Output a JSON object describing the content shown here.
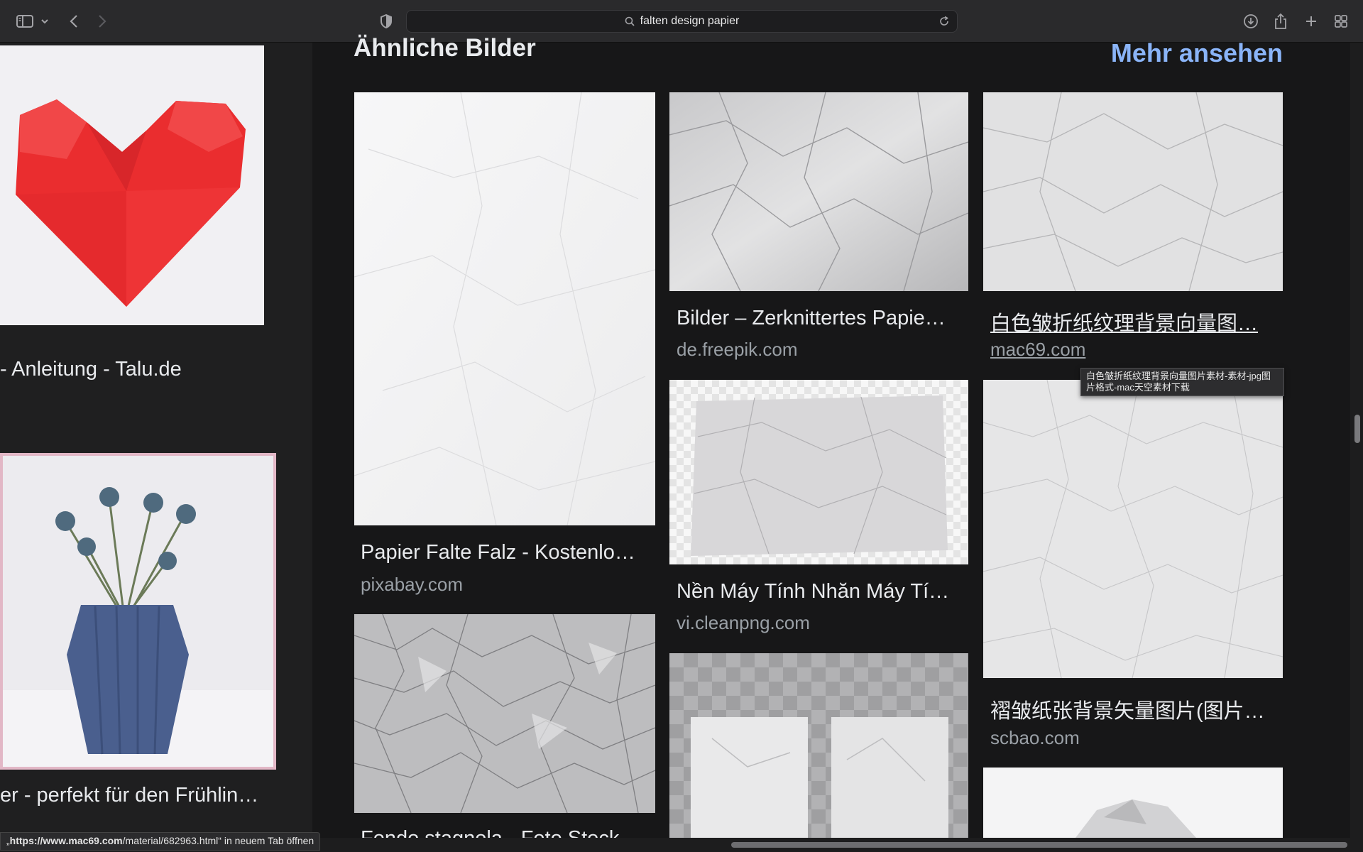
{
  "toolbar": {
    "address": "falten design papier",
    "icons": [
      "sidebar-icon",
      "chevron-down-icon",
      "back-icon",
      "forward-icon",
      "shield-icon",
      "search-icon",
      "reload-icon",
      "download-icon",
      "share-icon",
      "new-tab-icon",
      "tab-overview-icon"
    ]
  },
  "left": {
    "caption_top": "- Anleitung - Talu.de",
    "caption_bottom": "er - perfekt für den Frühlin…"
  },
  "section": {
    "title": "Ähnliche Bilder",
    "more": "Mehr ansehen"
  },
  "cards": [
    {
      "title": "Papier Falte Falz - Kostenlo…",
      "source": "pixabay.com"
    },
    {
      "title": "Bilder – Zerknittertes Papie…",
      "source": "de.freepik.com"
    },
    {
      "title": "白色皱折纸纹理背景向量图…",
      "source": "mac69.com"
    },
    {
      "title": "Nền Máy Tính Nhăn Máy Tí…",
      "source": "vi.cleanpng.com"
    },
    {
      "title": "褶皱纸张背景矢量图片(图片…",
      "source": "scbao.com"
    },
    {
      "title": "Fondo stagnola - Foto Stock…",
      "source": ""
    }
  ],
  "tooltip": "白色皱折纸纹理背景向量图片素材-素材-jpg图片格式-mac天空素材下载",
  "status": {
    "prefix": "„",
    "url_bold": "https://www.mac69.com",
    "url_rest": "/material/682963.html",
    "suffix": "“ in neuem Tab öffnen"
  },
  "colors": {
    "accent": "#8ab4f8",
    "panel": "#171718",
    "background": "#1f1f20"
  }
}
